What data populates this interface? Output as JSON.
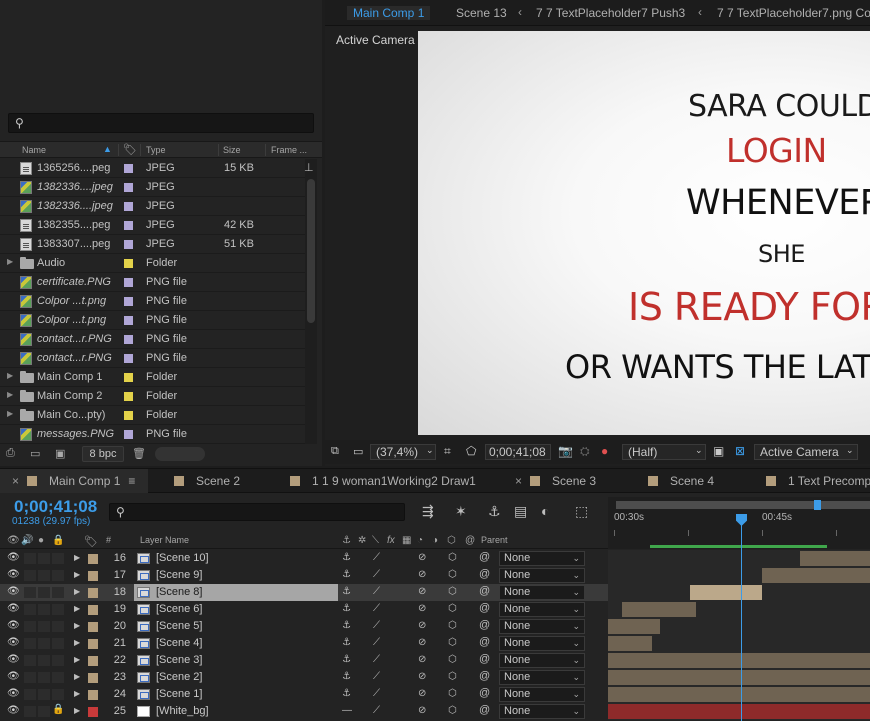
{
  "project": {
    "search_placeholder": "",
    "columns": {
      "name": "Name",
      "type": "Type",
      "size": "Size",
      "frame": "Frame ..."
    },
    "items": [
      {
        "name": "1365256....peg",
        "icon": "file-icon",
        "italic": false,
        "swatch": "#b0a6d6",
        "type": "JPEG",
        "size": "15 KB",
        "expandable": false
      },
      {
        "name": "1382336....jpeg",
        "icon": "image-icon",
        "italic": true,
        "swatch": "#b0a6d6",
        "type": "JPEG",
        "size": "",
        "expandable": false
      },
      {
        "name": "1382336....jpeg",
        "icon": "image-icon",
        "italic": true,
        "swatch": "#b0a6d6",
        "type": "JPEG",
        "size": "",
        "expandable": false
      },
      {
        "name": "1382355....peg",
        "icon": "file-icon",
        "italic": false,
        "swatch": "#b0a6d6",
        "type": "JPEG",
        "size": "42 KB",
        "expandable": false
      },
      {
        "name": "1383307....peg",
        "icon": "file-icon",
        "italic": false,
        "swatch": "#b0a6d6",
        "type": "JPEG",
        "size": "51 KB",
        "expandable": false
      },
      {
        "name": "Audio",
        "icon": "folder-icon",
        "italic": false,
        "swatch": "#e3d24a",
        "type": "Folder",
        "size": "",
        "expandable": true
      },
      {
        "name": "certificate.PNG",
        "icon": "image-icon",
        "italic": true,
        "swatch": "#b0a6d6",
        "type": "PNG file",
        "size": "",
        "expandable": false
      },
      {
        "name": "Colpor ...t.png",
        "icon": "image-icon",
        "italic": true,
        "swatch": "#b0a6d6",
        "type": "PNG file",
        "size": "",
        "expandable": false
      },
      {
        "name": "Colpor ...t.png",
        "icon": "image-icon",
        "italic": true,
        "swatch": "#b0a6d6",
        "type": "PNG file",
        "size": "",
        "expandable": false
      },
      {
        "name": "contact...r.PNG",
        "icon": "image-icon",
        "italic": true,
        "swatch": "#b0a6d6",
        "type": "PNG file",
        "size": "",
        "expandable": false
      },
      {
        "name": "contact...r.PNG",
        "icon": "image-icon",
        "italic": true,
        "swatch": "#b0a6d6",
        "type": "PNG file",
        "size": "",
        "expandable": false
      },
      {
        "name": "Main Comp 1",
        "icon": "folder-icon",
        "italic": false,
        "swatch": "#e3d24a",
        "type": "Folder",
        "size": "",
        "expandable": true
      },
      {
        "name": "Main Comp 2",
        "icon": "folder-icon",
        "italic": false,
        "swatch": "#e3d24a",
        "type": "Folder",
        "size": "",
        "expandable": true
      },
      {
        "name": "Main Co...pty)",
        "icon": "folder-icon",
        "italic": false,
        "swatch": "#e3d24a",
        "type": "Folder",
        "size": "",
        "expandable": true
      },
      {
        "name": "messages.PNG",
        "icon": "image-icon",
        "italic": true,
        "swatch": "#b0a6d6",
        "type": "PNG file",
        "size": "",
        "expandable": false
      }
    ],
    "bpc": "8 bpc"
  },
  "viewer": {
    "tabs": [
      "Main Comp 1",
      "Scene 13",
      "7 7 TextPlaceholder7 Push3",
      "7 7 TextPlaceholder7.png Co"
    ],
    "camera_label": "Active Camera",
    "canvas_lines": [
      {
        "text": "SARA COULD",
        "color": "#1a1a1a"
      },
      {
        "text": "LOGIN",
        "color": "#c0302c"
      },
      {
        "text": "WHENEVER",
        "color": "#111111"
      },
      {
        "text": "SHE",
        "color": "#1a1a1a"
      },
      {
        "text": "IS READY FOR",
        "color": "#c0302c"
      },
      {
        "text": "OR WANTS THE LATE",
        "color": "#111111"
      }
    ],
    "footer": {
      "zoom": "(37,4%)",
      "timecode": "0;00;41;08",
      "resolution": "(Half)",
      "view": "Active Camera"
    }
  },
  "timeline": {
    "tabs": [
      {
        "label": "Main Comp 1",
        "active": true
      },
      {
        "label": "Scene 2",
        "active": false
      },
      {
        "label": "1 1 9 woman1Working2 Draw1",
        "active": false
      },
      {
        "label": "Scene 3",
        "active": false
      },
      {
        "label": "Scene 4",
        "active": false
      },
      {
        "label": "1 Text Precomp",
        "active": false
      }
    ],
    "timecode": "0;00;41;08",
    "frames": "01238 (29.97 fps)",
    "columns": {
      "num": "#",
      "layer_name": "Layer Name",
      "parent": "Parent"
    },
    "ruler": {
      "t1": "00:30s",
      "t2": "00:45s"
    },
    "playhead_seconds": 41.27,
    "layers": [
      {
        "num": "16",
        "name": "[Scene 10]",
        "label_color": "#b39d7c",
        "parent": "None",
        "selected": false,
        "locked": false,
        "solid": false
      },
      {
        "num": "17",
        "name": "[Scene 9]",
        "label_color": "#b39d7c",
        "parent": "None",
        "selected": false,
        "locked": false,
        "solid": false
      },
      {
        "num": "18",
        "name": "[Scene 8]",
        "label_color": "#b39d7c",
        "parent": "None",
        "selected": true,
        "locked": false,
        "solid": false
      },
      {
        "num": "19",
        "name": "[Scene 6]",
        "label_color": "#b39d7c",
        "parent": "None",
        "selected": false,
        "locked": false,
        "solid": false
      },
      {
        "num": "20",
        "name": "[Scene 5]",
        "label_color": "#b39d7c",
        "parent": "None",
        "selected": false,
        "locked": false,
        "solid": false
      },
      {
        "num": "21",
        "name": "[Scene 4]",
        "label_color": "#b39d7c",
        "parent": "None",
        "selected": false,
        "locked": false,
        "solid": false
      },
      {
        "num": "22",
        "name": "[Scene 3]",
        "label_color": "#b39d7c",
        "parent": "None",
        "selected": false,
        "locked": false,
        "solid": false
      },
      {
        "num": "23",
        "name": "[Scene 2]",
        "label_color": "#b39d7c",
        "parent": "None",
        "selected": false,
        "locked": false,
        "solid": false
      },
      {
        "num": "24",
        "name": "[Scene 1]",
        "label_color": "#b39d7c",
        "parent": "None",
        "selected": false,
        "locked": false,
        "solid": false
      },
      {
        "num": "25",
        "name": "[White_bg]",
        "label_color": "#c83a3a",
        "parent": "None",
        "selected": false,
        "locked": true,
        "solid": true
      }
    ]
  }
}
